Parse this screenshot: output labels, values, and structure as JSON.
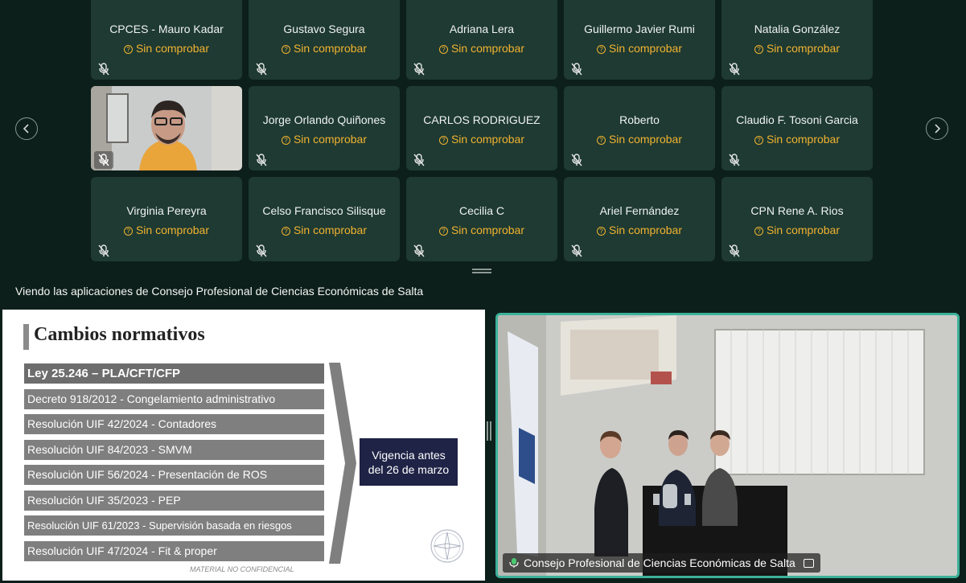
{
  "participants": [
    {
      "name": "CPCES - Mauro Kadar",
      "status": "Sin comprobar"
    },
    {
      "name": "Gustavo Segura",
      "status": "Sin comprobar"
    },
    {
      "name": "Adriana Lera",
      "status": "Sin comprobar"
    },
    {
      "name": "Guillermo Javier Rumi",
      "status": "Sin comprobar"
    },
    {
      "name": "Natalia González",
      "status": "Sin comprobar"
    },
    {
      "name": "",
      "status": "",
      "video": true
    },
    {
      "name": "Jorge Orlando Quiñones",
      "status": "Sin comprobar"
    },
    {
      "name": "CARLOS RODRIGUEZ",
      "status": "Sin comprobar"
    },
    {
      "name": "Roberto",
      "status": "Sin comprobar"
    },
    {
      "name": "Claudio F. Tosoni Garcia",
      "status": "Sin comprobar"
    },
    {
      "name": "Virginia Pereyra",
      "status": "Sin comprobar"
    },
    {
      "name": "Celso Francisco Silisque",
      "status": "Sin comprobar"
    },
    {
      "name": "Cecilia C",
      "status": "Sin comprobar"
    },
    {
      "name": "Ariel Fernández",
      "status": "Sin comprobar"
    },
    {
      "name": "CPN Rene A. Rios",
      "status": "Sin comprobar"
    }
  ],
  "nav": {
    "prev_icon": "chevron-left-icon",
    "next_icon": "chevron-right-icon"
  },
  "sharing": {
    "viewing_text": "Viendo las aplicaciones de Consejo Profesional de Ciencias Económicas de Salta"
  },
  "slide": {
    "title": "Cambios normativos",
    "rows": [
      "Ley 25.246 – PLA/CFT/CFP",
      "Decreto 918/2012 - Congelamiento administrativo",
      "Resolución UIF 42/2024 - Contadores",
      "Resolución UIF 84/2023 - SMVM",
      "Resolución UIF 56/2024 - Presentación de ROS",
      "Resolución UIF 35/2023 - PEP",
      "Resolución UIF 61/2023 - Supervisión basada en riesgos",
      "Resolución UIF 47/2024 - Fit & proper"
    ],
    "vigencia_line1": "Vigencia antes",
    "vigencia_line2": "del 26 de marzo",
    "footer_note": "MATERIAL NO CONFIDENCIAL"
  },
  "camera": {
    "label": "Consejo Profesional de Ciencias Económicas de Salta"
  },
  "colors": {
    "status": "#f2b230",
    "tile": "#1e3a32",
    "active_border": "#3cb19a",
    "background": "#0d1f1a"
  }
}
